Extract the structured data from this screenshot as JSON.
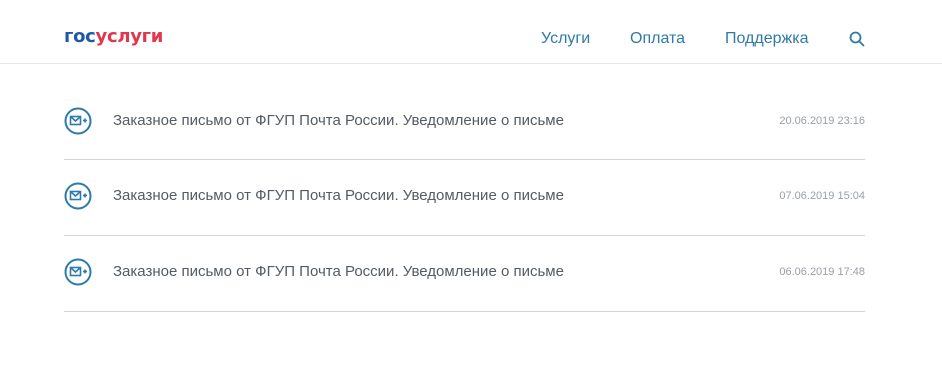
{
  "header": {
    "logo_part1": "гос",
    "logo_part2": "услуги",
    "nav": [
      {
        "label": "Услуги"
      },
      {
        "label": "Оплата"
      },
      {
        "label": "Поддержка"
      }
    ],
    "search_icon": "search-icon"
  },
  "notifications": [
    {
      "icon": "mail-icon",
      "title": "Заказное письмо от ФГУП Почта России. Уведомление о письме",
      "date": "20.06.2019 23:16"
    },
    {
      "icon": "mail-icon",
      "title": "Заказное письмо от ФГУП Почта России. Уведомление о письме",
      "date": "07.06.2019 15:04"
    },
    {
      "icon": "mail-icon",
      "title": "Заказное письмо от ФГУП Почта России. Уведомление о письме",
      "date": "06.06.2019 17:48"
    }
  ],
  "colors": {
    "brand_blue": "#1d5aa6",
    "brand_red": "#e0364e",
    "link": "#2e7aa8",
    "icon": "#2e7aa8"
  }
}
